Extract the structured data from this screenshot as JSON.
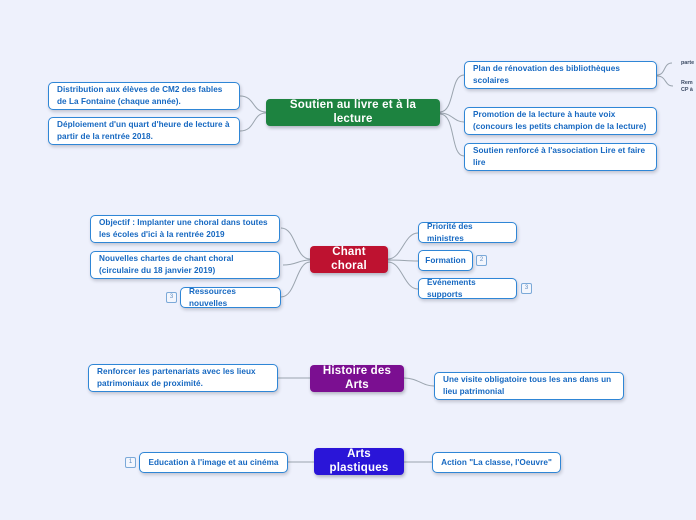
{
  "background_color": "#eef1fc",
  "connector_color": "#9aa4ae",
  "branches": [
    {
      "id": "soutien-livre-lecture",
      "root": {
        "label": "Soutien au livre et à la lecture",
        "color": "#1d8340"
      },
      "left_children": [
        {
          "label": "Distribution aux élèves de CM2 des fables de La Fontaine (chaque année)."
        },
        {
          "label": "Déploiement d'un quart d'heure de lecture à partir de la rentrée 2018."
        }
      ],
      "right_children": [
        {
          "label": "Plan de rénovation des bibliothèques scolaires"
        },
        {
          "label": "Promotion de la lecture à haute voix (concours les petits champion de la lecture)"
        },
        {
          "label": "Soutien renforcé à l'association Lire et faire lire"
        }
      ]
    },
    {
      "id": "chant-choral",
      "root": {
        "label": "Chant choral",
        "color": "#be1230"
      },
      "left_children": [
        {
          "label": "Objectif : Implanter une choral dans toutes les écoles d'ici à la rentrée 2019"
        },
        {
          "label": "Nouvelles chartes de chant choral (circulaire du 18 janvier 2019)"
        },
        {
          "label": "Ressources nouvelles",
          "badge": "3",
          "badge_side": "left"
        }
      ],
      "right_children": [
        {
          "label": "Priorité des ministres"
        },
        {
          "label": "Formation",
          "badge": "2",
          "badge_side": "right"
        },
        {
          "label": "Evénements supports",
          "badge": "3",
          "badge_side": "right"
        }
      ]
    },
    {
      "id": "histoire-des-arts",
      "root": {
        "label": "Histoire des Arts",
        "color": "#7b0f91"
      },
      "left_children": [
        {
          "label": "Renforcer les partenariats avec les lieux patrimoniaux de proximité."
        }
      ],
      "right_children": [
        {
          "label": "Une visite obligatoire tous les ans dans un lieu patrimonial"
        }
      ]
    },
    {
      "id": "arts-plastiques",
      "root": {
        "label": "Arts plastiques",
        "color": "#2a15d8"
      },
      "left_children": [
        {
          "label": "Education à l'image et au cinéma",
          "badge": "1",
          "badge_side": "left"
        }
      ],
      "right_children": [
        {
          "label": "Action \"La classe, l'Oeuvre\""
        }
      ]
    }
  ],
  "edge_labels": [
    {
      "text": "parte"
    },
    {
      "text": "Rem"
    },
    {
      "text": "CP à"
    }
  ]
}
